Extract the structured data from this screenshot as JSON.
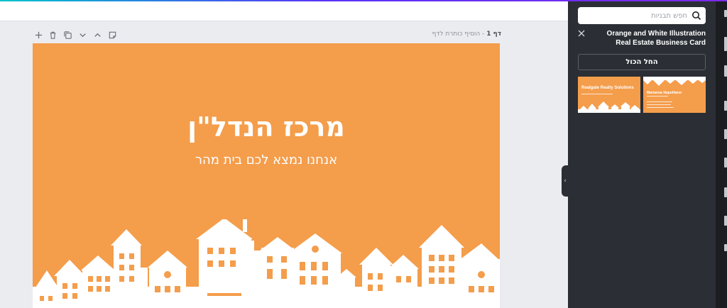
{
  "page": {
    "label_number": "דף 1",
    "label_title_hint": "- הוסיף כותרת לדף"
  },
  "design": {
    "title": "מרכז הנדל\"ן",
    "subtitle": "אנחנו נמצא לכם בית מהר",
    "background_color": "#f49d4b",
    "foreground_color": "#ffffff"
  },
  "panel": {
    "search_placeholder": "חפש תבניות",
    "template_title": "Orange and White Illustration Real Estate Business Card",
    "apply_all_label": "החל הכול",
    "thumbnails": [
      {
        "main_text": "Realgate Realty Solutions",
        "sub_text": ""
      },
      {
        "main_text": "Marianna Napolitano"
      }
    ]
  },
  "icons": {
    "toolbar": [
      "plus-icon",
      "trash-icon",
      "duplicate-icon",
      "chevron-down-icon",
      "chevron-up-icon",
      "note-icon"
    ],
    "panel": [
      "search-icon",
      "close-icon"
    ],
    "collapse": "chevron-left-icon"
  },
  "colors": {
    "accent_gradient_start": "#00c4cc",
    "accent_gradient_end": "#7d2ae8",
    "panel_bg": "#2b2f35",
    "canvas_bg": "#ebecf0"
  }
}
